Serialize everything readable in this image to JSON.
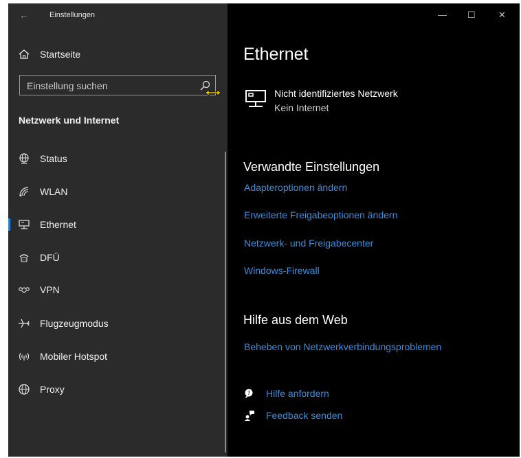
{
  "window": {
    "app_title": "Einstellungen",
    "back_glyph": "←",
    "controls": {
      "minimize": "—",
      "maximize": "☐",
      "close": "✕"
    }
  },
  "sidebar": {
    "home_label": "Startseite",
    "search_placeholder": "Einstellung suchen",
    "section_title": "Netzwerk und Internet",
    "items": [
      {
        "label": "Status",
        "icon": "globe-status-icon",
        "selected": false
      },
      {
        "label": "WLAN",
        "icon": "wifi-icon",
        "selected": false
      },
      {
        "label": "Ethernet",
        "icon": "ethernet-icon",
        "selected": true
      },
      {
        "label": "DFÜ",
        "icon": "dialup-icon",
        "selected": false
      },
      {
        "label": "VPN",
        "icon": "vpn-icon",
        "selected": false
      },
      {
        "label": "Flugzeugmodus",
        "icon": "airplane-icon",
        "selected": false
      },
      {
        "label": "Mobiler Hotspot",
        "icon": "hotspot-icon",
        "selected": false
      },
      {
        "label": "Proxy",
        "icon": "globe-icon",
        "selected": false
      }
    ]
  },
  "main": {
    "title": "Ethernet",
    "network": {
      "name": "Nicht identifiziertes Netzwerk",
      "status": "Kein Internet"
    },
    "related_title": "Verwandte Einstellungen",
    "related_links": [
      "Adapteroptionen ändern",
      "Erweiterte Freigabeoptionen ändern",
      "Netzwerk- und Freigabecenter",
      "Windows-Firewall"
    ],
    "help_title": "Hilfe aus dem Web",
    "help_links": [
      "Beheben von Netzwerkverbindungsproblemen"
    ],
    "actions": [
      {
        "label": "Hilfe anfordern",
        "icon": "help-chat-icon"
      },
      {
        "label": "Feedback senden",
        "icon": "feedback-icon"
      }
    ]
  },
  "colors": {
    "sidebar_bg": "#2b2b2b",
    "content_bg": "#000000",
    "link": "#3a8edc",
    "selection_accent": "#2a86d8",
    "cursor_accent": "#f0c400"
  }
}
